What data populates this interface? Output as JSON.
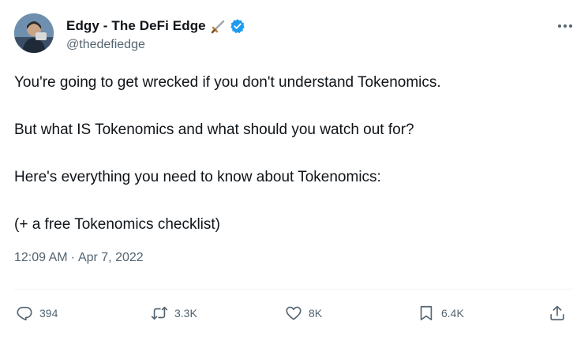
{
  "author": {
    "display_name": "Edgy - The DeFi Edge",
    "handle": "@thedefiedge",
    "avatar_icon": "avatar-person-icon",
    "name_emoji_icon": "sword-icon",
    "verified_icon": "verified-badge-icon"
  },
  "tweet": {
    "lines": [
      "You're going to get wrecked if you don't understand Tokenomics.",
      "But what IS Tokenomics and what should you watch out for?",
      "Here's everything you need to know about Tokenomics:",
      "(+ a free Tokenomics checklist)"
    ],
    "time": "12:09 AM",
    "separator": "·",
    "date": "Apr 7, 2022"
  },
  "actions": {
    "reply": {
      "icon": "reply-icon",
      "count": "394"
    },
    "retweet": {
      "icon": "retweet-icon",
      "count": "3.3K"
    },
    "like": {
      "icon": "heart-icon",
      "count": "8K"
    },
    "bookmark": {
      "icon": "bookmark-icon",
      "count": "6.4K"
    },
    "share": {
      "icon": "share-icon"
    }
  },
  "menu": {
    "icon": "more-icon"
  },
  "colors": {
    "text": "#0f1419",
    "secondary": "#536471",
    "verified": "#1d9bf0",
    "divider": "#eff3f4"
  }
}
